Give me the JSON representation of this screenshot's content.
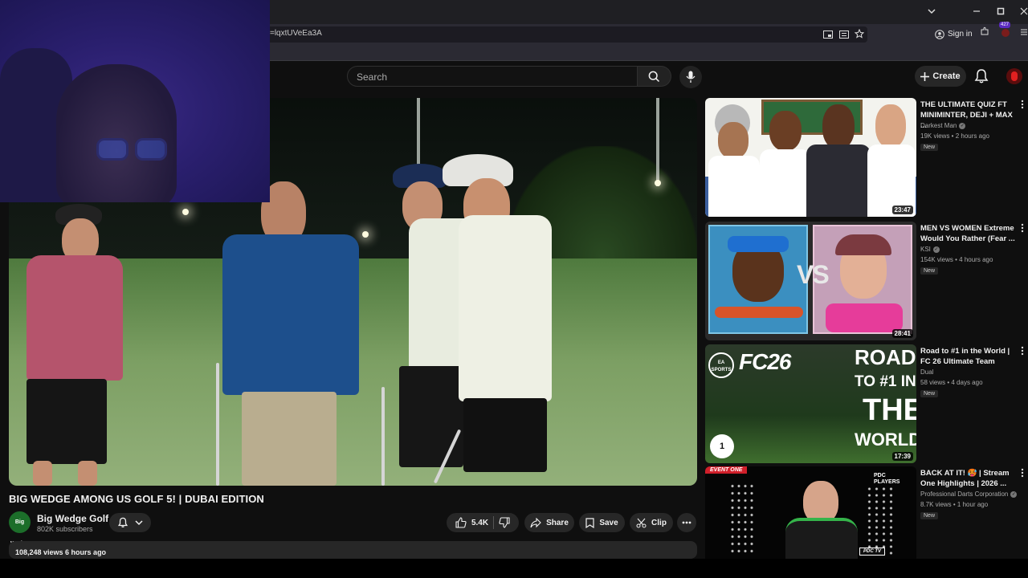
{
  "browser": {
    "url_fragment": "=lqxtUVeEa3A",
    "signin_label": "Sign in",
    "extension_badge": "427"
  },
  "header": {
    "search_placeholder": "Search",
    "create_label": "Create"
  },
  "video": {
    "title": "BIG WEDGE AMONG US GOLF 5! | DUBAI EDITION",
    "channel_name": "Big Wedge Golf",
    "channel_avatar_text": "Big Wedge",
    "subscribers": "802K subscribers",
    "likes": "5.4K",
    "share_label": "Share",
    "save_label": "Save",
    "clip_label": "Clip",
    "views_time": "108,248 views  6 hours ago"
  },
  "recommendations": [
    {
      "title": "THE ULTIMATE QUIZ FT MINIMINTER, DEJI + MAX ...",
      "channel": "Darkest Man",
      "verified": true,
      "meta": "19K views • 2 hours ago",
      "badge": "New",
      "duration": "23:47"
    },
    {
      "title": "MEN VS WOMEN Extreme Would You Rather (Fear ...",
      "channel": "KSI",
      "verified": true,
      "meta": "154K views • 4 hours ago",
      "badge": "New",
      "duration": "28:41",
      "thumb_text": "VS"
    },
    {
      "title": "Road to #1 in the World | FC 26 Ultimate Team",
      "channel": "Dual",
      "verified": false,
      "meta": "58 views • 4 days ago",
      "badge": "New",
      "duration": "17:39",
      "thumb_logo": "EA SPORTS",
      "thumb_game": "FC26",
      "thumb_line1": "ROAD",
      "thumb_line2": "TO #1 IN",
      "thumb_line3": "THE",
      "thumb_line4": "WORLD",
      "thumb_rank": "1"
    },
    {
      "title": "BACK AT IT! 🥵 | Stream One Highlights | 2026 ...",
      "channel": "Professional Darts Corporation",
      "verified": true,
      "meta": "8.7K views • 1 hour ago",
      "badge": "New",
      "thumb_tag": "EVENT ONE",
      "thumb_brand": "PDC PLAYERS",
      "thumb_tv": "PDC TV"
    }
  ],
  "colors": {
    "background": "#0f0f0f",
    "pill": "#272727",
    "text_primary": "#f1f1f1",
    "text_secondary": "#aaaaaa",
    "brand_red": "#ff0000"
  }
}
